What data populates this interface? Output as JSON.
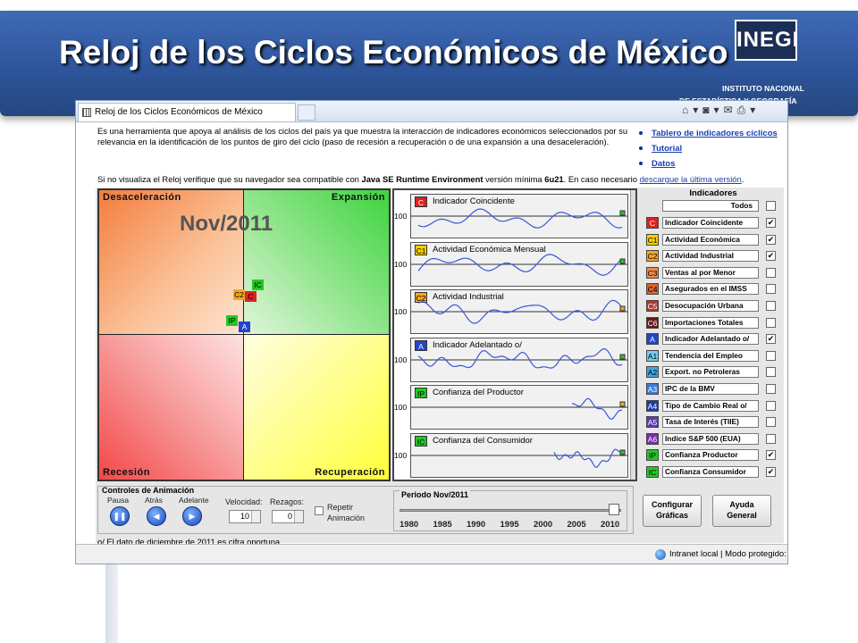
{
  "slide": {
    "title": "Reloj de  los Ciclos Económicos de México",
    "logo": {
      "text": "INEGI",
      "line1": "INSTITUTO NACIONAL",
      "line2": "DE ESTADÍSTICA Y GEOGRAFÍA"
    }
  },
  "browser": {
    "tab_title": "Reloj de los Ciclos Económicos de México",
    "toolbar_icons": [
      "home-icon",
      "feeds-icon",
      "mail-icon",
      "print-icon"
    ],
    "status_text": "Intranet local | Modo protegido: d"
  },
  "page": {
    "intro": "Es una herramienta que apoya al análisis de los ciclos del país ya que muestra la interacción de indicadores económicos seleccionados por su relevancia en la identificación de los puntos de giro del ciclo (paso de recesión a recuperación o de una expansión a una desaceleración).",
    "links": [
      "Tablero de indicadores cíclicos",
      "Tutorial",
      "Datos"
    ],
    "version_prefix": "Si no visualiza el Reloj verifique que su navegador sea compatible con ",
    "version_bold": "Java SE Runtime Environment",
    "version_mid": " versión mínima ",
    "version_min": "6u21",
    "version_suffix": ". En caso necesario ",
    "version_link": "descargue la última versión",
    "version_end": ".",
    "note": "o/ El dato de diciembre de 2011 es cifra oportuna."
  },
  "clock": {
    "period": "Nov/2011",
    "quadrants": {
      "top_left": "Desaceleración",
      "top_right": "Expansión",
      "bottom_left": "Recesión",
      "bottom_right": "Recuperación"
    },
    "markers": [
      {
        "code": "IC",
        "color": "#22c822"
      },
      {
        "code": "C2",
        "color": "#f5a623"
      },
      {
        "code": "C",
        "color": "#e02020"
      },
      {
        "code": "IP",
        "color": "#22c822"
      },
      {
        "code": "A",
        "color": "#2244cc"
      }
    ]
  },
  "charts": {
    "baseline_label": "100",
    "rows": [
      {
        "code": "C",
        "label": "Indicador Coincidente",
        "color": "#e02020",
        "end": "#22c822"
      },
      {
        "code": "C1",
        "label": "Actividad Económica Mensual",
        "color": "#f5d000",
        "end": "#22c822"
      },
      {
        "code": "C2",
        "label": "Actividad Industrial",
        "color": "#f5a623",
        "end": "#f5a623"
      },
      {
        "code": "A",
        "label": "Indicador Adelantado o/",
        "color": "#2244cc",
        "end": "#22c822"
      },
      {
        "code": "IP",
        "label": "Confianza del Productor",
        "color": "#22c822",
        "end": "#f5a623"
      },
      {
        "code": "IC",
        "label": "Confianza del Consumidor",
        "color": "#22c822",
        "end": "#22c822"
      }
    ]
  },
  "indicators": {
    "title": "Indicadores",
    "all_label": "Todos",
    "items": [
      {
        "code": "C",
        "label": "Indicador Coincidente",
        "color": "#e02020",
        "checked": true
      },
      {
        "code": "C1",
        "label": "Actividad Económica",
        "color": "#f5d000",
        "checked": true
      },
      {
        "code": "C2",
        "label": "Actividad Industrial",
        "color": "#f5a623",
        "checked": true
      },
      {
        "code": "C3",
        "label": "Ventas al por Menor",
        "color": "#f08a4b",
        "checked": false
      },
      {
        "code": "C4",
        "label": "Asegurados en el IMSS",
        "color": "#e0602a",
        "checked": false
      },
      {
        "code": "C5",
        "label": "Desocupación Urbana",
        "color": "#b03a2a",
        "checked": false
      },
      {
        "code": "C6",
        "label": "Importaciones Totales",
        "color": "#6a1a1a",
        "checked": false
      },
      {
        "code": "A",
        "label": "Indicador Adelantado o/",
        "color": "#2244cc",
        "checked": true
      },
      {
        "code": "A1",
        "label": "Tendencia del Empleo",
        "color": "#6fd0f0",
        "checked": false
      },
      {
        "code": "A2",
        "label": "Export. no Petroleras",
        "color": "#40a8e0",
        "checked": false
      },
      {
        "code": "A3",
        "label": "IPC de la BMV",
        "color": "#3a7ad8",
        "checked": false
      },
      {
        "code": "A4",
        "label": "Tipo de Cambio Real o/",
        "color": "#1d3fa8",
        "checked": false
      },
      {
        "code": "A5",
        "label": "Tasa de Interés (TIIE)",
        "color": "#5a3ab0",
        "checked": false
      },
      {
        "code": "A6",
        "label": "Indice S&P 500 (EUA)",
        "color": "#7a2aa8",
        "checked": false
      },
      {
        "code": "IP",
        "label": "Confianza Productor",
        "color": "#22c822",
        "checked": true
      },
      {
        "code": "IC",
        "label": "Confianza Consumidor",
        "color": "#22c822",
        "checked": true
      }
    ]
  },
  "controls": {
    "title": "Controles de Animación",
    "pause": "Pausa",
    "back": "Atrás",
    "forward": "Adelante",
    "speed_label": "Velocidad:",
    "speed_value": "10",
    "lag_label": "Rezagos:",
    "lag_value": "0",
    "repeat_line1": "Repetir",
    "repeat_line2": "Animación",
    "period_title": "Periodo Nov/2011",
    "years": [
      "1980",
      "1985",
      "1990",
      "1995",
      "2000",
      "2005",
      "2010"
    ],
    "slider_fraction": 0.99,
    "configure_line1": "Configurar",
    "configure_line2": "Gráficas",
    "help_line1": "Ayuda",
    "help_line2": "General"
  }
}
